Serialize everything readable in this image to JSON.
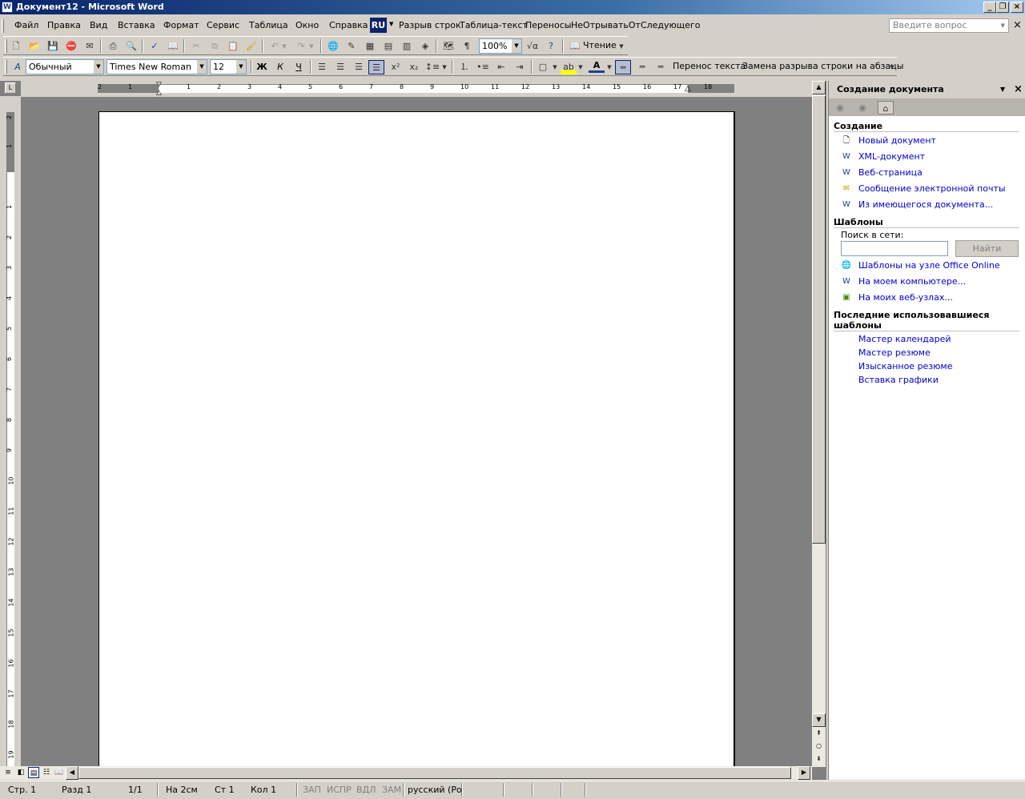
{
  "window": {
    "title": "Документ12 - Microsoft Word"
  },
  "menu": {
    "items": [
      "Файл",
      "Правка",
      "Вид",
      "Вставка",
      "Формат",
      "Сервис",
      "Таблица",
      "Окно",
      "Справка"
    ],
    "lang_badge": "RU",
    "extra": [
      "Разрыв строк",
      "Таблица-текст",
      "Переносы",
      "НеОтрыватьОтСледующего"
    ],
    "ask_placeholder": "Введите вопрос"
  },
  "standard_toolbar": {
    "zoom": "100%",
    "reading_label": "Чтение"
  },
  "formatting_toolbar": {
    "style": "Обычный",
    "font": "Times New Roman",
    "size": "12",
    "bold": "Ж",
    "italic": "К",
    "underline": "Ч",
    "wrap_text": "Перенос текста",
    "replace_breaks": "Замена разрыва строки на абзацы"
  },
  "ruler": {
    "h_numbers": [
      "2",
      "1",
      "1",
      "2",
      "3",
      "4",
      "5",
      "6",
      "7",
      "8",
      "9",
      "10",
      "11",
      "12",
      "13",
      "14",
      "15",
      "16",
      "17",
      "18"
    ],
    "v_numbers": [
      "2",
      "1",
      "1",
      "2",
      "3",
      "4",
      "5",
      "6",
      "7",
      "8",
      "9",
      "10",
      "11",
      "12",
      "13",
      "14",
      "15",
      "16",
      "17",
      "18",
      "19"
    ]
  },
  "status": {
    "page": "Стр. 1",
    "section": "Разд 1",
    "pages": "1/1",
    "at": "На 2см",
    "line": "Ст 1",
    "col": "Кол 1",
    "rec": "ЗАП",
    "trk": "ИСПР",
    "ext": "ВДЛ",
    "ovr": "ЗАМ",
    "lang": "русский (Ро"
  },
  "taskpane": {
    "title": "Создание документа",
    "section_create": "Создание",
    "create_links": [
      "Новый документ",
      "XML-документ",
      "Веб-страница",
      "Сообщение электронной почты",
      "Из имеющегося документа..."
    ],
    "section_templates": "Шаблоны",
    "search_label": "Поиск в сети:",
    "find_button": "Найти",
    "template_links": [
      "Шаблоны на узле Office Online",
      "На моем компьютере...",
      "На моих веб-узлах..."
    ],
    "section_recent": "Последние использовавшиеся шаблоны",
    "recent_links": [
      "Мастер календарей",
      "Мастер резюме",
      "Изысканное резюме",
      "Вставка графики"
    ]
  }
}
